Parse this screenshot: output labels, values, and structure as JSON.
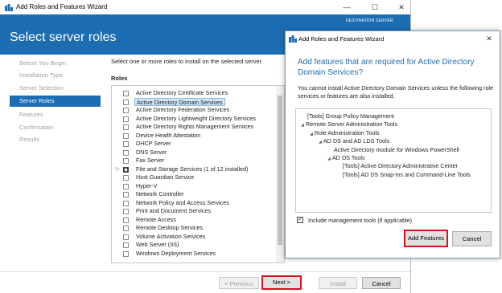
{
  "main": {
    "title": "Add Roles and Features Wizard",
    "page_title": "Select server roles",
    "destination_server": "DESTINATION SERVER",
    "nav": [
      {
        "label": "Before You Begin",
        "active": false
      },
      {
        "label": "Installation Type",
        "active": false
      },
      {
        "label": "Server Selection",
        "active": false
      },
      {
        "label": "Server Roles",
        "active": true
      },
      {
        "label": "Features",
        "active": false
      },
      {
        "label": "Confirmation",
        "active": false
      },
      {
        "label": "Results",
        "active": false
      }
    ],
    "intro": "Select one or more roles to install on the selected server.",
    "roles_label": "Roles",
    "roles": [
      {
        "label": "Active Directory Certificate Services",
        "state": "unchecked"
      },
      {
        "label": "Active Directory Domain Services",
        "state": "unchecked",
        "selected": true
      },
      {
        "label": "Active Directory Federation Services",
        "state": "unchecked"
      },
      {
        "label": "Active Directory Lightweight Directory Services",
        "state": "unchecked"
      },
      {
        "label": "Active Directory Rights Management Services",
        "state": "unchecked"
      },
      {
        "label": "Device Health Attestation",
        "state": "unchecked"
      },
      {
        "label": "DHCP Server",
        "state": "unchecked"
      },
      {
        "label": "DNS Server",
        "state": "unchecked"
      },
      {
        "label": "Fax Server",
        "state": "unchecked"
      },
      {
        "label": "File and Storage Services (1 of 12 installed)",
        "state": "partial",
        "expandable": true
      },
      {
        "label": "Host Guardian Service",
        "state": "unchecked"
      },
      {
        "label": "Hyper-V",
        "state": "unchecked"
      },
      {
        "label": "Network Controller",
        "state": "unchecked"
      },
      {
        "label": "Network Policy and Access Services",
        "state": "unchecked"
      },
      {
        "label": "Print and Document Services",
        "state": "unchecked"
      },
      {
        "label": "Remote Access",
        "state": "unchecked"
      },
      {
        "label": "Remote Desktop Services",
        "state": "unchecked"
      },
      {
        "label": "Volume Activation Services",
        "state": "unchecked"
      },
      {
        "label": "Web Server (IIS)",
        "state": "unchecked"
      },
      {
        "label": "Windows Deployment Services",
        "state": "unchecked"
      }
    ],
    "buttons": {
      "previous": "< Previous",
      "next": "Next >",
      "install": "Install",
      "cancel": "Cancel"
    }
  },
  "dialog": {
    "title": "Add Roles and Features Wizard",
    "heading": "Add features that are required for Active Directory Domain Services?",
    "body": "You cannot install Active Directory Domain Services unless the following role services or features are also installed.",
    "tree": [
      {
        "label": "[Tools] Group Policy Management",
        "level": 0,
        "arrow": false
      },
      {
        "label": "Remote Server Administration Tools",
        "level": 0,
        "arrow": true
      },
      {
        "label": "Role Administration Tools",
        "level": 1,
        "arrow": true
      },
      {
        "label": "AD DS and AD LDS Tools",
        "level": 2,
        "arrow": true
      },
      {
        "label": "Active Directory module for Windows PowerShell",
        "level": 3,
        "arrow": false
      },
      {
        "label": "AD DS Tools",
        "level": 3,
        "arrow": true
      },
      {
        "label": "[Tools] Active Directory Administrative Center",
        "level": 4,
        "arrow": false
      },
      {
        "label": "[Tools] AD DS Snap-Ins and Command-Line Tools",
        "level": 4,
        "arrow": false
      }
    ],
    "include_tools_label": "Include management tools (if applicable)",
    "include_tools_checked": true,
    "add_features": "Add Features",
    "cancel": "Cancel",
    "close_glyph": "✕"
  },
  "window_controls": {
    "minimize": "—",
    "maximize": "☐",
    "close": "✕"
  },
  "colors": {
    "accent": "#1d6db2",
    "highlight_border": "#d7141e"
  }
}
